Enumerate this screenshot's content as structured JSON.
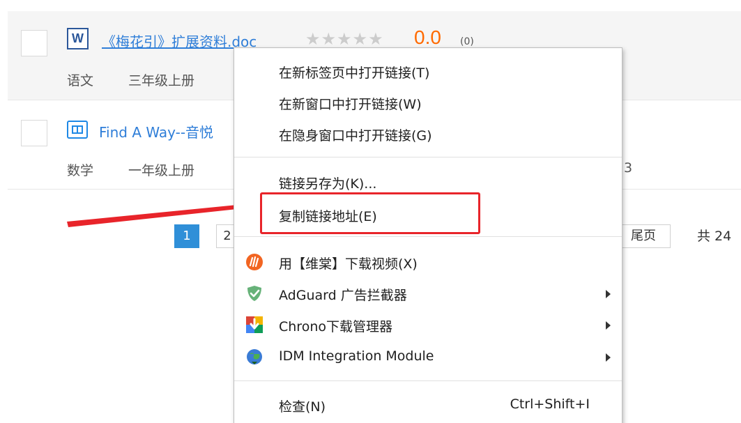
{
  "list": {
    "items": [
      {
        "icon": "word-doc-icon",
        "title": "《梅花引》扩展资料.doc",
        "stars": "★★★★★",
        "score": "0.0",
        "score_count": "(0)",
        "subject": "语文",
        "grade": "三年级上册"
      },
      {
        "icon": "video-icon",
        "title": "Find A Way--音悦",
        "subject": "数学",
        "grade": "一年级上册",
        "trailing": "3"
      }
    ]
  },
  "pagination": {
    "current": "1",
    "next_partial": "2",
    "last_label": "尾页",
    "total_partial": "共 24"
  },
  "context_menu": {
    "items": [
      {
        "label": "在新标签页中打开链接(T)"
      },
      {
        "label": "在新窗口中打开链接(W)"
      },
      {
        "label": "在隐身窗口中打开链接(G)"
      },
      {
        "label": "链接另存为(K)..."
      },
      {
        "label": "复制链接地址(E)",
        "highlighted": true
      },
      {
        "label": "用【维棠】下载视频(X)",
        "icon": "weitang-icon"
      },
      {
        "label": "AdGuard 广告拦截器",
        "icon": "adguard-shield-icon",
        "submenu": true
      },
      {
        "label": "Chrono下载管理器",
        "icon": "chrono-download-icon",
        "submenu": true
      },
      {
        "label": "IDM Integration Module",
        "icon": "idm-globe-icon",
        "submenu": true
      },
      {
        "label": "检查(N)",
        "shortcut": "Ctrl+Shift+I"
      }
    ]
  },
  "colors": {
    "link": "#2f7ed8",
    "score": "#ff6a00",
    "highlight": "#e8242a",
    "active_page": "#2f8fd8"
  }
}
